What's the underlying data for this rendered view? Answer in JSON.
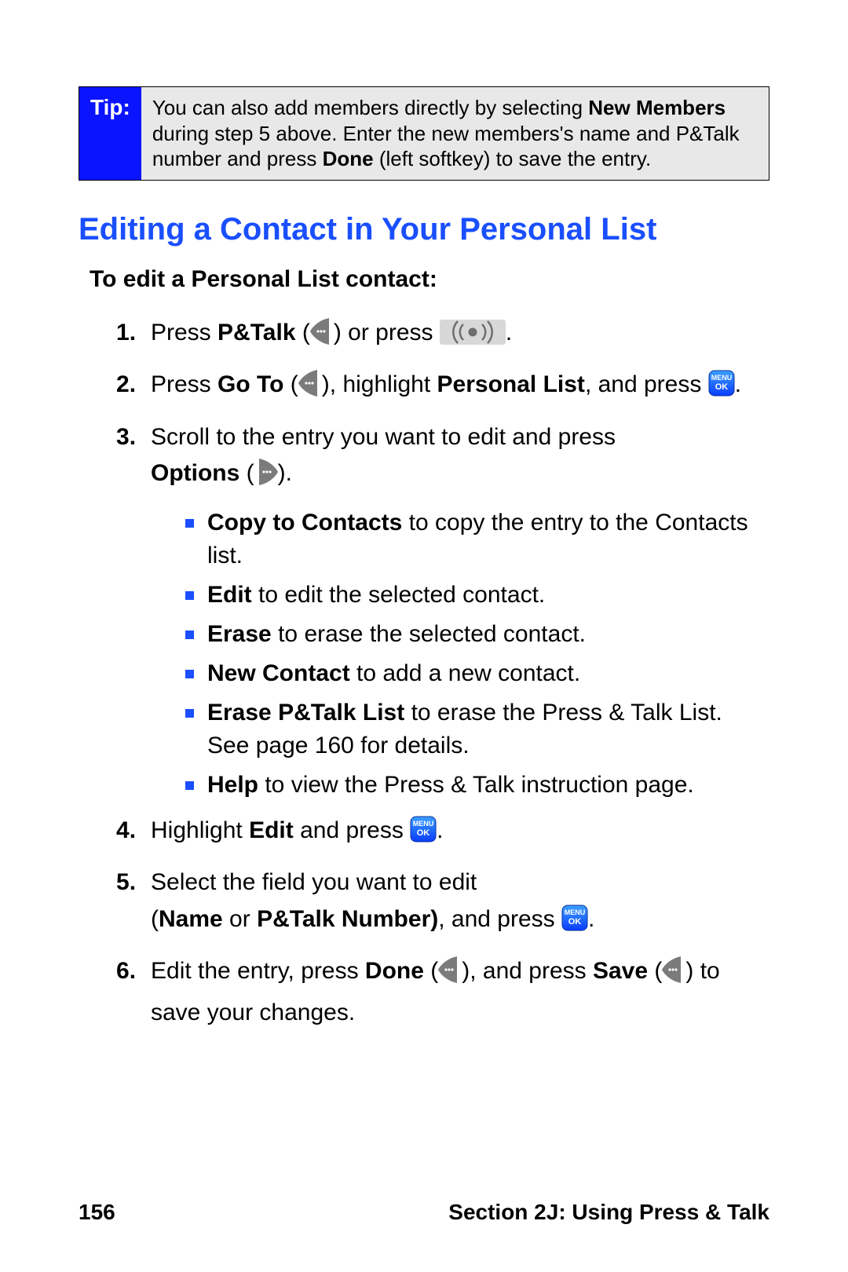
{
  "tip": {
    "label": "Tip:",
    "text_pre": "You can also add members directly by selecting ",
    "bold1": "New Members",
    "text_mid": " during step 5 above. Enter the new members's name and P&Talk number and press ",
    "bold2": "Done",
    "text_post": " (left softkey) to save the entry."
  },
  "heading": "Editing a Contact in Your Personal List",
  "intro": "To edit a Personal List contact:",
  "steps": {
    "s1": {
      "pre": "Press ",
      "b1": "P&Talk",
      "mid": " (",
      "after_icon1": ") or press ",
      "end": "."
    },
    "s2": {
      "pre": "Press ",
      "b1": "Go To",
      "mid": " (",
      "after_icon1": "), highlight ",
      "b2": "Personal List",
      "after_b2": ", and press ",
      "end": "."
    },
    "s3": {
      "line1": "Scroll to the entry you want to edit and press",
      "opt_b": "Options",
      "opt_open": " (",
      "opt_close": ").",
      "sub": {
        "a": {
          "b": "Copy to Contacts",
          "rest": " to copy the entry to the Contacts list."
        },
        "b": {
          "b": "Edit",
          "rest": " to edit the selected contact."
        },
        "c": {
          "b": "Erase",
          "rest": " to erase the selected contact."
        },
        "d": {
          "b": "New Contact",
          "rest": " to add a new contact."
        },
        "e": {
          "b": "Erase P&Talk List",
          "rest": " to erase the Press & Talk List. See page 160 for details."
        },
        "f": {
          "b": "Help",
          "rest": " to view the Press & Talk instruction page."
        }
      }
    },
    "s4": {
      "pre": "Highlight ",
      "b1": "Edit",
      "mid": " and press ",
      "end": "."
    },
    "s5": {
      "line1": "Select the field you want to edit",
      "open": "(",
      "b1": "Name",
      "or": " or ",
      "b2": "P&Talk Number)",
      "mid": ", and press ",
      "end": "."
    },
    "s6": {
      "pre": "Edit the entry, press ",
      "b1": "Done",
      "mid1": " (",
      "after1": "), and press ",
      "b2": "Save",
      "mid2": " (",
      "after2": ") to save your changes."
    }
  },
  "footer": {
    "page": "156",
    "section": "Section 2J: Using Press & Talk"
  }
}
